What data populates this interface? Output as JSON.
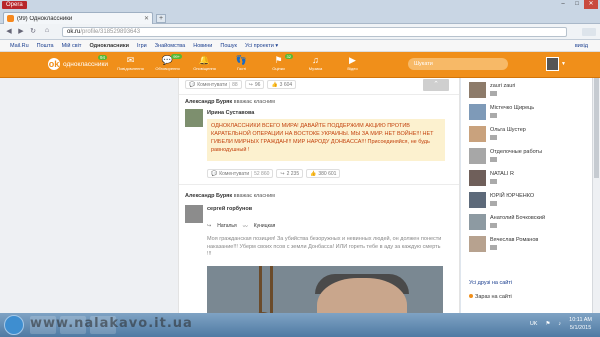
{
  "browser": {
    "menu_label": "Opera",
    "tab_title": "(99) Одноклассники",
    "url_host": "ok.ru",
    "url_path": "/profile/318529893643"
  },
  "portal": {
    "links": [
      "Mail.Ru",
      "Пошта",
      "Мій світ",
      "Однокласники",
      "Ігри",
      "Знайомства",
      "Новини",
      "Пошук",
      "Усі проекти ▾"
    ],
    "exit": "вихід"
  },
  "ok_header": {
    "logo": "одноклассники",
    "logo_badge": "94",
    "menu": [
      {
        "label": "Повідомлення",
        "icon": "envelope-icon",
        "glyph": "✉",
        "badge": ""
      },
      {
        "label": "Обговорення",
        "icon": "comments-icon",
        "glyph": "💬",
        "badge": "99+"
      },
      {
        "label": "Оповіщення",
        "icon": "bell-icon",
        "glyph": "🔔",
        "badge": ""
      },
      {
        "label": "Гості",
        "icon": "footprints-icon",
        "glyph": "👣",
        "badge": ""
      },
      {
        "label": "Оцінки",
        "icon": "like-icon",
        "glyph": "⚑",
        "badge": "32"
      },
      {
        "label": "Музика",
        "icon": "music-icon",
        "glyph": "♫",
        "badge": ""
      },
      {
        "label": "Відео",
        "icon": "video-icon",
        "glyph": "▶",
        "badge": ""
      }
    ],
    "search_placeholder": "Шукати"
  },
  "top_stats": {
    "comment_label": "Коментувати",
    "comment_count": "88",
    "share_count": "96",
    "like_count": "3 604"
  },
  "post1": {
    "header_user": "Александр Буряк",
    "header_action": "вважає класним",
    "author": "Ирина Суставова",
    "text": "ОДНОКЛАССНИКИ ВСЕГО МИРА! ДАВАЙТЕ ПОДДЕРЖИМ АКЦИЮ ПРОТИВ КАРАТЕЛЬНОЙ ОПЕРАЦИИ НА ВОСТОКЕ УКРАИНЫ. МЫ ЗА МИР. НЕТ ВОЙНЕ!!! НЕТ ГИБЕЛИ МИРНЫХ ГРАЖДАН!!! МИР НАРОДУ ДОНБАССА!!! Присоединяйся, не будь равнодушный !",
    "comment_label": "Коментувати",
    "comment_count": "52 860",
    "share_count": "2 235",
    "like_count": "380 601"
  },
  "post2": {
    "header_user": "Александр Буряк",
    "header_action": "вважає класним",
    "author": "сергей горбунов",
    "gift_from": "Наталья",
    "gift_to": "Куницкая",
    "text": "Моя гражданская позиция! За убийства безоружных и невинных людей, он должен понести наказание!!! Уберм своих псов с земли Донбасса! ИЛИ гореть тебе в аду за каждую смерть !!!"
  },
  "friends": [
    {
      "name": "zauri zauri"
    },
    {
      "name": "Мiстечко Щирець"
    },
    {
      "name": "Ольга Шустер"
    },
    {
      "name": "Отделочные работы"
    },
    {
      "name": "NATALI R"
    },
    {
      "name": "ЮРІЙ ЮРЧЕНКО"
    },
    {
      "name": "Анатолий Бочковский"
    },
    {
      "name": "Вячеслав Романов"
    }
  ],
  "rightcol": {
    "all_friends": "Усі друзі на сайті",
    "online": "Зараз на сайті"
  },
  "taskbar": {
    "watermark": "www.nalakavo.it.ua",
    "lang": "UK",
    "time": "10:11 AM",
    "date": "5/1/2015"
  }
}
